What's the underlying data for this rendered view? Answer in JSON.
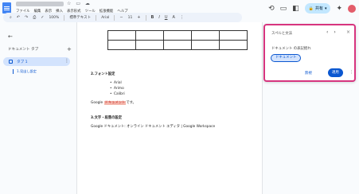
{
  "app": {
    "title_icons": [
      "☆",
      "▭",
      "☁"
    ]
  },
  "menu": {
    "items": [
      "ファイル",
      "編集",
      "表示",
      "挿入",
      "表示形式",
      "ツール",
      "拡張機能",
      "ヘルプ"
    ]
  },
  "toolbar": {
    "zoom": "100%",
    "style": "標準テキスト",
    "font": "Arial",
    "font_size": "11"
  },
  "header_right": {
    "share_label": "共有",
    "share_icon": "lock-icon"
  },
  "left_panel": {
    "tabs_heading": "ドキュメント タブ",
    "tab_label": "タブ 1",
    "outline_item": "1.見出し設定"
  },
  "document": {
    "heading2": "2.フォント設定",
    "bullets": [
      "Arial",
      "Arimo",
      "Calibri"
    ],
    "line_prefix": "Google ",
    "highlighted_word": "ドキュメント",
    "line_suffix": "です。",
    "heading3": "3.文字・段落の設定",
    "body_line": "Google ドキュメント: オンライン ドキュメント エディタ | Google Workspace"
  },
  "explore_panel": {
    "title": "スペルと文法",
    "label": "ドキュメント の表記揺れ",
    "chip": "ドキュメント",
    "cancel": "無視",
    "apply": "適用"
  },
  "colors": {
    "accent": "#0b57d0",
    "highlight_border": "#d7357f",
    "highlight_bg": "#f4b8ad"
  }
}
